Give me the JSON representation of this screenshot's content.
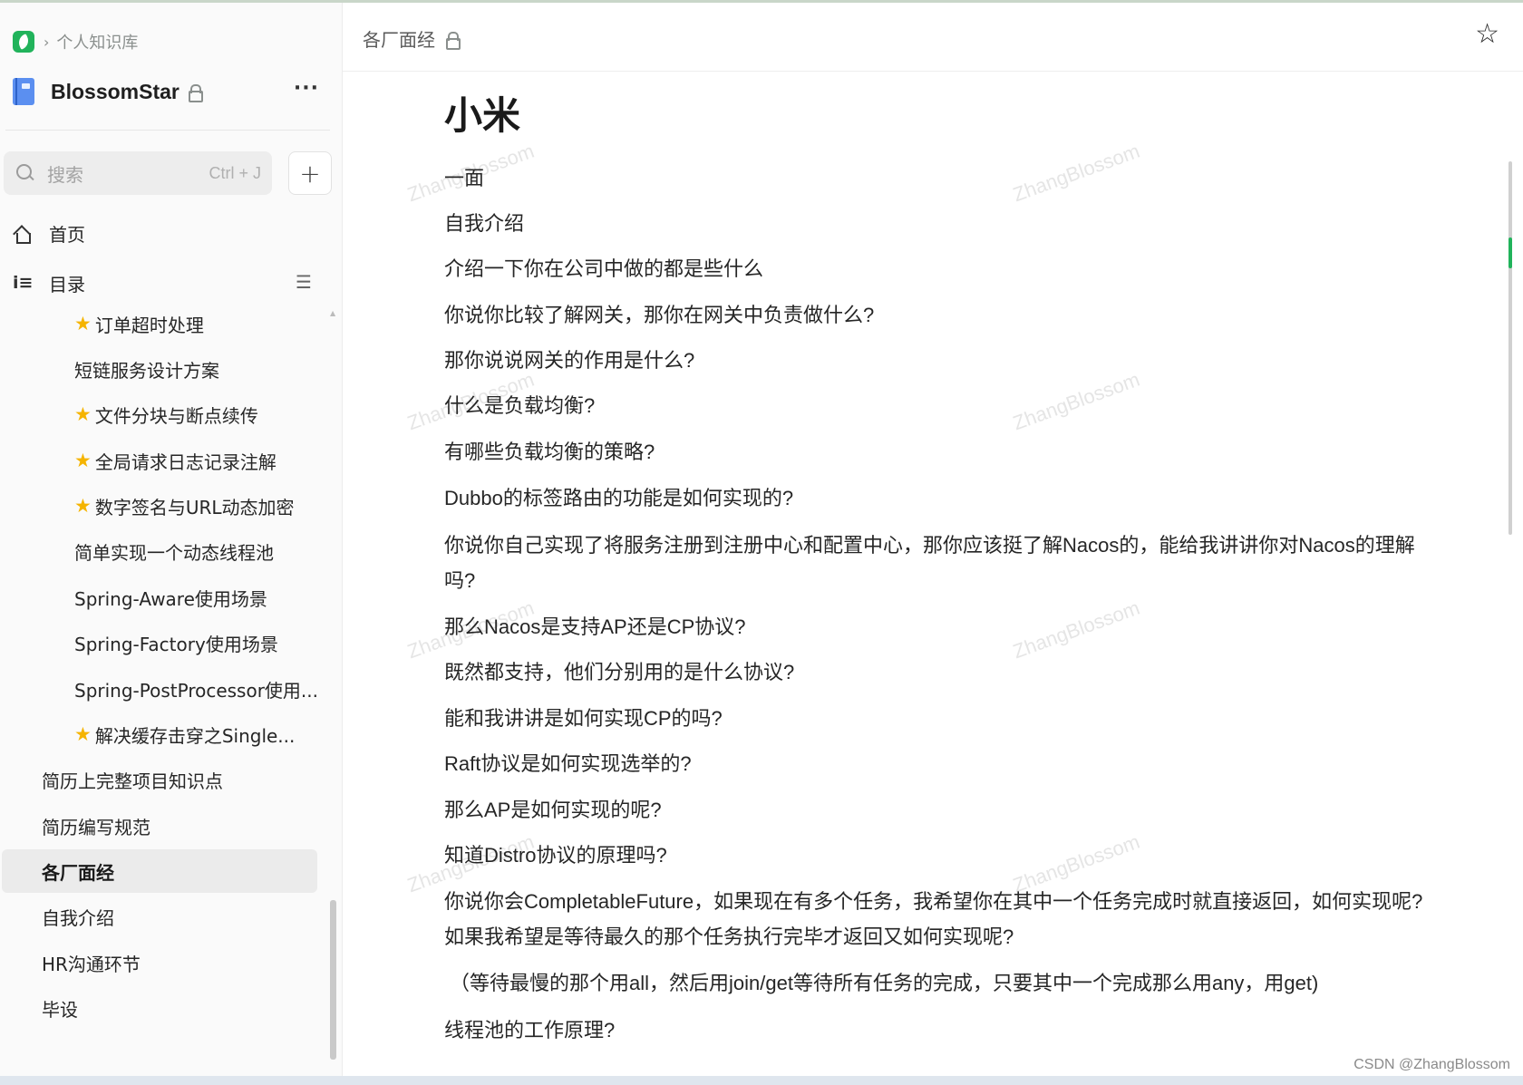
{
  "breadcrumb": {
    "label": "个人知识库"
  },
  "book": {
    "title": "BlossomStar",
    "more_label": "···"
  },
  "search": {
    "placeholder": "搜索",
    "shortcut": "Ctrl + J",
    "add_label": "+"
  },
  "nav": {
    "home_label": "首页",
    "toc_label": "目录"
  },
  "toc": {
    "items": [
      {
        "label": "订单超时处理",
        "starred": true,
        "level": 2
      },
      {
        "label": "短链服务设计方案",
        "starred": false,
        "level": 2
      },
      {
        "label": "文件分块与断点续传",
        "starred": true,
        "level": 2
      },
      {
        "label": "全局请求日志记录注解",
        "starred": true,
        "level": 2
      },
      {
        "label": "数字签名与URL动态加密",
        "starred": true,
        "level": 2
      },
      {
        "label": "简单实现一个动态线程池",
        "starred": false,
        "level": 2
      },
      {
        "label": "Spring-Aware使用场景",
        "starred": false,
        "level": 2
      },
      {
        "label": "Spring-Factory使用场景",
        "starred": false,
        "level": 2
      },
      {
        "label": "Spring-PostProcessor使用...",
        "starred": false,
        "level": 2
      },
      {
        "label": "解决缓存击穿之Single...",
        "starred": true,
        "level": 2
      },
      {
        "label": "简历上完整项目知识点",
        "starred": false,
        "level": 1
      },
      {
        "label": "简历编写规范",
        "starred": false,
        "level": 1
      },
      {
        "label": "各厂面经",
        "starred": false,
        "level": 1,
        "active": true
      },
      {
        "label": "自我介绍",
        "starred": false,
        "level": 1
      },
      {
        "label": "HR沟通环节",
        "starred": false,
        "level": 1
      },
      {
        "label": "毕设",
        "starred": false,
        "level": 1
      }
    ]
  },
  "header": {
    "doc_crumb": "各厂面经"
  },
  "document": {
    "title": "小米",
    "paragraphs": [
      "一面",
      "自我介绍",
      "介绍一下你在公司中做的都是些什么",
      "你说你比较了解网关，那你在网关中负责做什么?",
      "那你说说网关的作用是什么?",
      "什么是负载均衡?",
      "有哪些负载均衡的策略?",
      "Dubbo的标签路由的功能是如何实现的?",
      "你说你自己实现了将服务注册到注册中心和配置中心，那你应该挺了解Nacos的，能给我讲讲你对Nacos的理解吗?",
      "那么Nacos是支持AP还是CP协议?",
      "既然都支持，他们分别用的是什么协议?",
      "能和我讲讲是如何实现CP的吗?",
      "Raft协议是如何实现选举的?",
      "那么AP是如何实现的呢?",
      "知道Distro协议的原理吗?",
      "你说你会CompletableFuture，如果现在有多个任务，我希望你在其中一个任务完成时就直接返回，如何实现呢? 如果我希望是等待最久的那个任务执行完毕才返回又如何实现呢?",
      "（等待最慢的那个用all，然后用join/get等待所有任务的完成，只要其中一个完成那么用any，用get)",
      "线程池的工作原理?"
    ],
    "watermark": "ZhangBlossom"
  },
  "footer": {
    "credit": "CSDN @ZhangBlossom"
  },
  "colors": {
    "accent": "#21b35b",
    "star": "#f5b400",
    "active_bg": "#ebebeb"
  }
}
